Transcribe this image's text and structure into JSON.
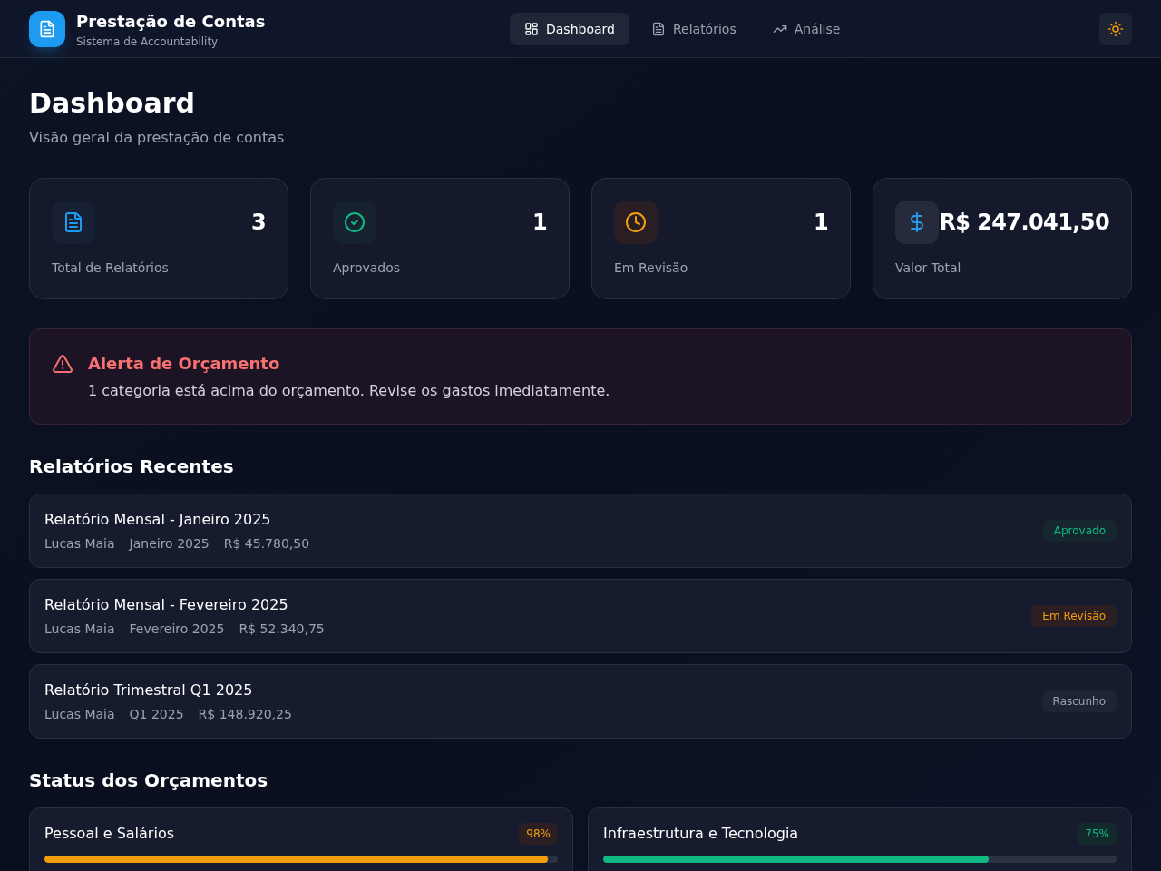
{
  "header": {
    "title": "Prestação de Contas",
    "subtitle": "Sistema de Accountability",
    "nav": [
      {
        "label": "Dashboard",
        "kind": "dashboard",
        "selected": true
      },
      {
        "label": "Relatórios",
        "kind": "reports",
        "selected": false
      },
      {
        "label": "Análise",
        "kind": "analysis",
        "selected": false
      }
    ]
  },
  "page": {
    "title": "Dashboard",
    "subtitle": "Visão geral da prestação de contas"
  },
  "stats": [
    {
      "kind": "reports",
      "value": "3",
      "label": "Total de Relatórios"
    },
    {
      "kind": "approved",
      "value": "1",
      "label": "Aprovados"
    },
    {
      "kind": "review",
      "value": "1",
      "label": "Em Revisão"
    },
    {
      "kind": "money",
      "value": "R$ 247.041,50",
      "label": "Valor Total"
    }
  ],
  "alert": {
    "title": "Alerta de Orçamento",
    "message": "1 categoria está acima do orçamento. Revise os gastos imediatamente."
  },
  "recent": {
    "title": "Relatórios Recentes",
    "items": [
      {
        "title": "Relatório Mensal - Janeiro 2025",
        "author": "Lucas Maia",
        "period": "Janeiro 2025",
        "amount": "R$ 45.780,50",
        "status": "Aprovado",
        "kind": "approved"
      },
      {
        "title": "Relatório Mensal - Fevereiro 2025",
        "author": "Lucas Maia",
        "period": "Fevereiro 2025",
        "amount": "R$ 52.340,75",
        "status": "Em Revisão",
        "kind": "review"
      },
      {
        "title": "Relatório Trimestral Q1 2025",
        "author": "Lucas Maia",
        "period": "Q1 2025",
        "amount": "R$ 148.920,25",
        "status": "Rascunho",
        "kind": "draft"
      }
    ]
  },
  "budgets": {
    "title": "Status dos Orçamentos",
    "items": [
      {
        "name": "Pessoal e Salários",
        "percent": "98%",
        "level": 0.98,
        "kind": "warning"
      },
      {
        "name": "Infraestrutura e Tecnologia",
        "percent": "75%",
        "level": 0.75,
        "kind": "ok"
      }
    ]
  }
}
